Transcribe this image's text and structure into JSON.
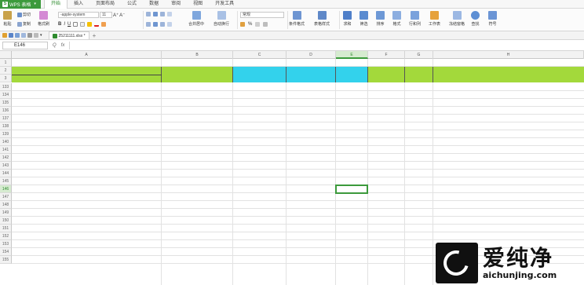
{
  "app": {
    "name": "WPS 表格",
    "logo_text": "S"
  },
  "menu": {
    "tabs": [
      "开始",
      "插入",
      "页面布局",
      "公式",
      "数据",
      "审阅",
      "视图",
      "开发工具"
    ],
    "active_index": 0
  },
  "ribbon": {
    "paste": "粘贴",
    "cut": "剪切",
    "copy": "复制",
    "format_painter": "格式刷",
    "font_name": "-apple-system",
    "font_size": "11",
    "bold": "B",
    "italic": "I",
    "underline": "U",
    "merge_center": "合并居中",
    "wrap_text": "自动换行",
    "number_format": "常规",
    "percent": "%",
    "conditional_format": "条件格式",
    "table_style": "表格样式",
    "sum": "求和",
    "filter": "筛选",
    "sort": "排序",
    "format": "格式",
    "row_col": "行和列",
    "worksheet": "工作表",
    "freeze": "冻结窗格",
    "find": "查找",
    "symbol": "符号"
  },
  "doc_tab": {
    "name": "25211111.xlsx *"
  },
  "formula_bar": {
    "cell_ref": "E146",
    "fx": "fx",
    "zoom_glyph": "Q"
  },
  "grid": {
    "columns": [
      "A",
      "B",
      "C",
      "D",
      "E",
      "F",
      "G",
      "H"
    ],
    "active_column": "E",
    "rows": [
      "1",
      "2",
      "3",
      "133",
      "134",
      "135",
      "136",
      "137",
      "138",
      "139",
      "140",
      "141",
      "142",
      "143",
      "144",
      "145",
      "146",
      "147",
      "148",
      "149",
      "150",
      "151",
      "152",
      "153",
      "154",
      "155"
    ],
    "active_row": "146",
    "colors": {
      "green": "#a3d93b",
      "cyan": "#33d2ec",
      "selection": "#3c9a3c"
    }
  },
  "watermark": {
    "chinese": "爱纯净",
    "url": "aichunjing.com"
  }
}
